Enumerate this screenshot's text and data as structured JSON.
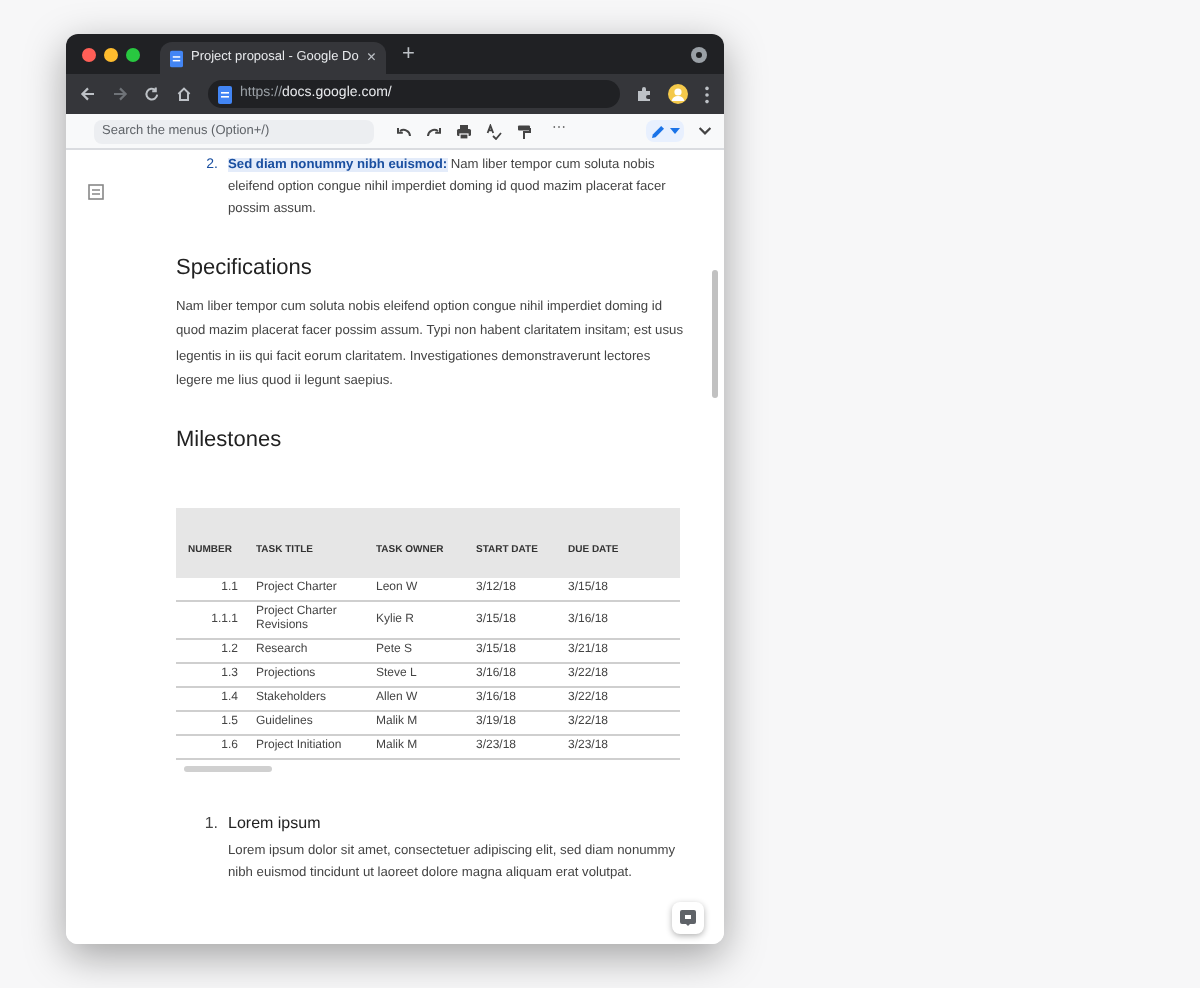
{
  "browser": {
    "tab_title": "Project proposal - Google Do",
    "tab_close": "×",
    "new_tab": "+",
    "url_scheme": "https://",
    "url_host": "docs.google.com/"
  },
  "docs_toolbar": {
    "search_placeholder": "Search the menus (Option+/)",
    "more": "⋯"
  },
  "document": {
    "list_item": {
      "number": "2.",
      "text": "**Sed diam nonummy nibh euismod:** Nam liber tempor cum soluta nobis eleifend option congue nihil imperdiet doming id quod mazim placerat facer possim assum."
    },
    "specifications": {
      "heading": "Specifications",
      "paragraph": "Nam liber tempor cum soluta nobis eleifend option congue nihil imperdiet doming id quod mazim placerat facer possim assum. Typi non habent claritatem insitam; est usus legentis in iis qui facit eorum claritatem. Investigationes demonstraverunt lectores legere me lius quod ii legunt saepius."
    },
    "milestones": {
      "heading": "Milestones",
      "table": {
        "columns": [
          "NUMBER",
          "TASK TITLE",
          "TASK OWNER",
          "START DATE",
          "DUE DATE"
        ],
        "rows": [
          [
            "1.1",
            "Project Charter",
            "Leon W",
            "3/12/18",
            "3/15/18"
          ],
          [
            "1.1.1",
            "Project Charter Revisions",
            "Kylie R",
            "3/15/18",
            "3/16/18"
          ],
          [
            "1.2",
            "Research",
            "Pete S",
            "3/15/18",
            "3/21/18"
          ],
          [
            "1.3",
            "Projections",
            "Steve L",
            "3/16/18",
            "3/22/18"
          ],
          [
            "1.4",
            "Stakeholders",
            "Allen W",
            "3/16/18",
            "3/22/18"
          ],
          [
            "1.5",
            "Guidelines",
            "Malik M",
            "3/19/18",
            "3/22/18"
          ],
          [
            "1.6",
            "Project Initiation",
            "Malik M",
            "3/23/18",
            "3/23/18"
          ]
        ]
      }
    },
    "lorem": {
      "number": "1.",
      "heading": "Lorem ipsum",
      "paragraph": "Lorem ipsum dolor sit amet, consectetuer adipiscing elit, sed diam nonummy nibh euismod tincidunt ut laoreet dolore magna aliquam erat volutpat."
    }
  }
}
